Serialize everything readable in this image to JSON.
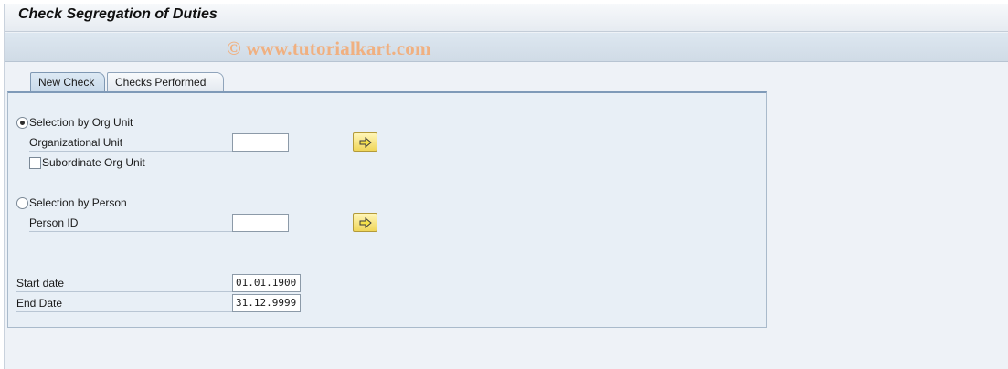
{
  "title": "Check Segregation of Duties",
  "watermark": "© www.tutorialkart.com",
  "tabs": [
    {
      "label": "New Check",
      "active": true
    },
    {
      "label": "Checks Performed",
      "active": false
    }
  ],
  "form": {
    "org_unit_radio_label": "Selection by Org Unit",
    "org_unit_label": "Organizational Unit",
    "org_unit_value": "",
    "subordinate_label": "Subordinate Org Unit",
    "person_radio_label": "Selection by Person",
    "person_id_label": "Person ID",
    "person_id_value": "",
    "start_date_label": "Start date",
    "start_date_value": "01.01.1900",
    "end_date_label": "End Date",
    "end_date_value": "31.12.9999"
  },
  "state": {
    "org_unit_radio_selected": true,
    "person_radio_selected": false,
    "subordinate_checked": false
  },
  "icons": {
    "execute_button_icon": "arrow-right-icon"
  },
  "colors": {
    "background": "#eef2f7",
    "panel": "#e8eff6",
    "button_fill": "#f0d65a"
  }
}
